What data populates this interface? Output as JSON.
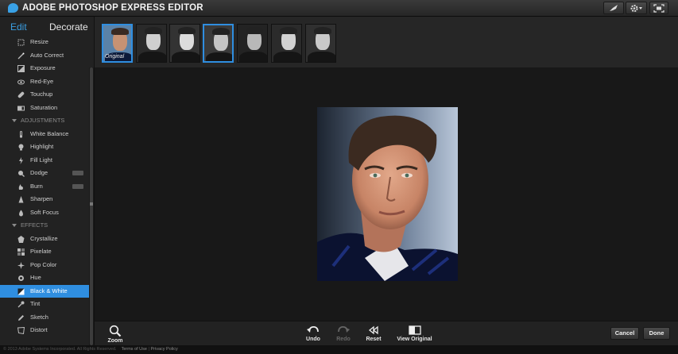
{
  "app": {
    "title": "ADOBE PHOTOSHOP EXPRESS EDITOR"
  },
  "sidebar": {
    "tabs": [
      {
        "label": "Edit"
      },
      {
        "label": "Decorate"
      }
    ],
    "items": [
      {
        "label": "Resize",
        "icon": "resize-icon"
      },
      {
        "label": "Auto Correct",
        "icon": "wand-icon"
      },
      {
        "label": "Exposure",
        "icon": "exposure-icon"
      },
      {
        "label": "Red-Eye",
        "icon": "eye-icon"
      },
      {
        "label": "Touchup",
        "icon": "bandage-icon"
      },
      {
        "label": "Saturation",
        "icon": "saturation-icon"
      }
    ],
    "adjustments_heading": "ADJUSTMENTS",
    "adjustments": [
      {
        "label": "White Balance",
        "icon": "thermometer-icon"
      },
      {
        "label": "Highlight",
        "icon": "bulb-icon"
      },
      {
        "label": "Fill Light",
        "icon": "flash-icon"
      },
      {
        "label": "Dodge",
        "icon": "dodge-icon",
        "badge": true
      },
      {
        "label": "Burn",
        "icon": "burn-icon",
        "badge": true
      },
      {
        "label": "Sharpen",
        "icon": "sharpen-icon"
      },
      {
        "label": "Soft Focus",
        "icon": "drop-icon"
      }
    ],
    "effects_heading": "EFFECTS",
    "effects": [
      {
        "label": "Crystallize",
        "icon": "crystal-icon"
      },
      {
        "label": "Pixelate",
        "icon": "pixelate-icon"
      },
      {
        "label": "Pop Color",
        "icon": "popcolor-icon"
      },
      {
        "label": "Hue",
        "icon": "hue-icon"
      },
      {
        "label": "Black & White",
        "icon": "bw-icon",
        "active": true
      },
      {
        "label": "Tint",
        "icon": "dropper-icon"
      },
      {
        "label": "Sketch",
        "icon": "pencil-icon"
      },
      {
        "label": "Distort",
        "icon": "distort-icon"
      }
    ]
  },
  "filmstrip": {
    "original_caption": "Original"
  },
  "toolbar": {
    "zoom_label": "Zoom",
    "undo_label": "Undo",
    "redo_label": "Redo",
    "reset_label": "Reset",
    "view_original_label": "View Original",
    "cancel_label": "Cancel",
    "done_label": "Done"
  },
  "footer": {
    "copyright": "© 2013 Adobe Systems Incorporated. All Rights Reserved.",
    "terms": "Terms of Use",
    "separator": "|",
    "privacy": "Privacy Policy"
  },
  "colors": {
    "accent": "#2f8ee0",
    "background": "#181818",
    "panel": "#222222"
  }
}
